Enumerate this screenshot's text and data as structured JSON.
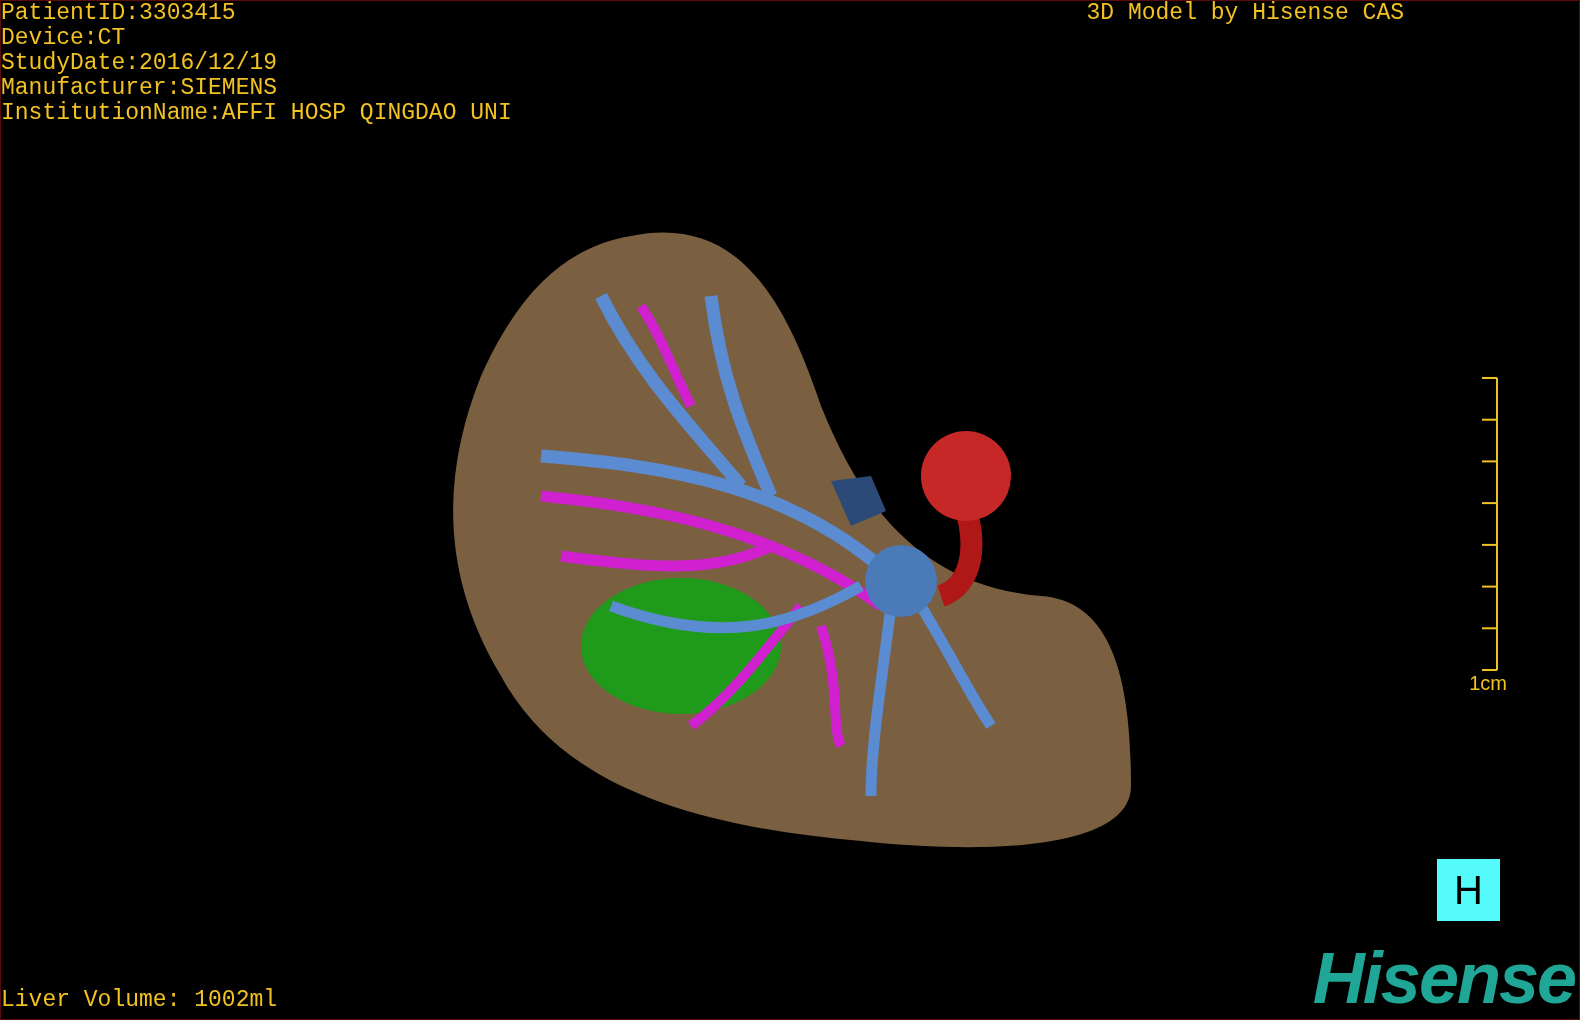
{
  "patient_info": [
    "PatientID:3303415",
    "Device:CT",
    "StudyDate:2016/12/19",
    "Manufacturer:SIEMENS",
    "InstitutionName:AFFI HOSP QINGDAO UNI"
  ],
  "title": "3D Model by Hisense CAS",
  "scale_label": "1cm",
  "orientation_marker": "H",
  "logo": "Hisense",
  "liver_volume": "Liver Volume: 1002ml"
}
